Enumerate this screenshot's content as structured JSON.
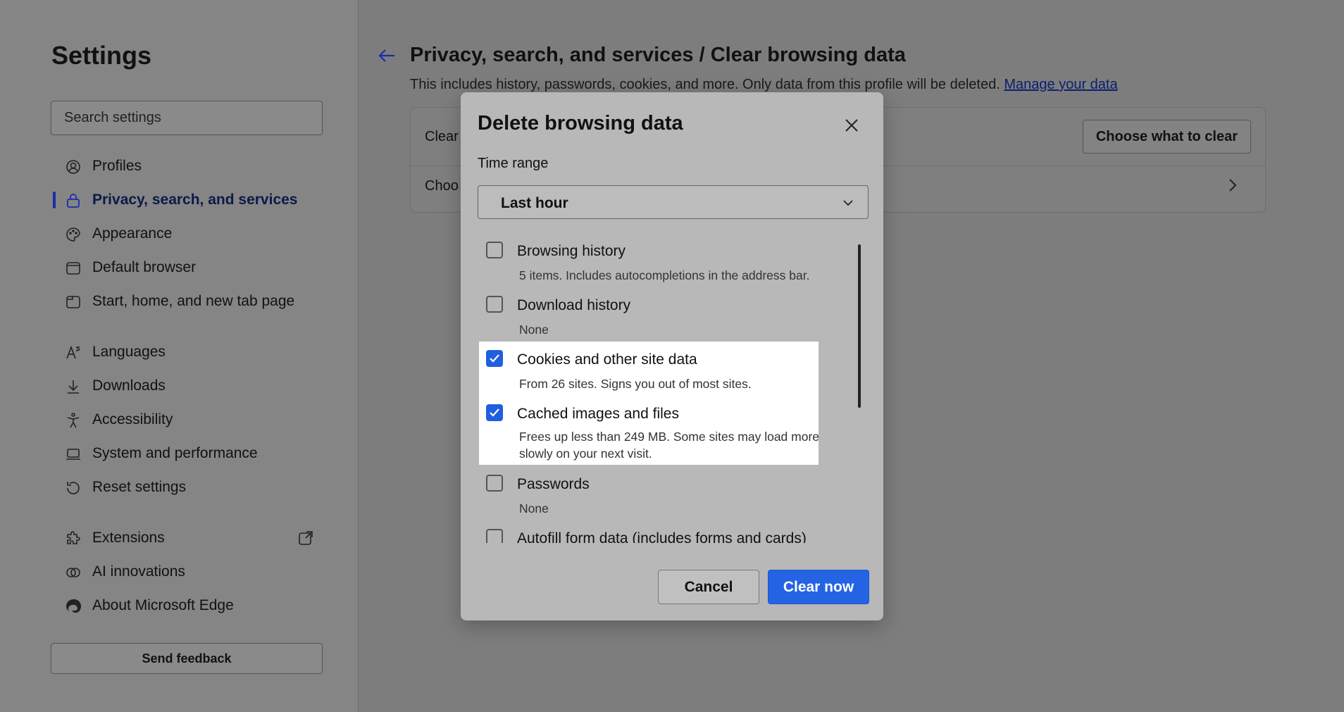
{
  "sidebar": {
    "title": "Settings",
    "search_placeholder": "Search settings",
    "items": [
      {
        "label": "Profiles",
        "icon": "profile-icon"
      },
      {
        "label": "Privacy, search, and services",
        "icon": "lock-icon",
        "active": true
      },
      {
        "label": "Appearance",
        "icon": "palette-icon"
      },
      {
        "label": "Default browser",
        "icon": "browser-icon"
      },
      {
        "label": "Start, home, and new tab page",
        "icon": "home-tab-icon"
      },
      {
        "label": "Languages",
        "icon": "languages-icon"
      },
      {
        "label": "Downloads",
        "icon": "download-icon"
      },
      {
        "label": "Accessibility",
        "icon": "accessibility-icon"
      },
      {
        "label": "System and performance",
        "icon": "laptop-icon"
      },
      {
        "label": "Reset settings",
        "icon": "reset-icon"
      },
      {
        "label": "Extensions",
        "icon": "puzzle-icon"
      },
      {
        "label": "AI innovations",
        "icon": "ai-icon"
      },
      {
        "label": "About Microsoft Edge",
        "icon": "edge-icon"
      }
    ],
    "feedback_label": "Send feedback"
  },
  "main": {
    "title": "Privacy, search, and services / Clear browsing data",
    "description": "This includes history, passwords, cookies, and more. Only data from this profile will be deleted.",
    "manage_link": "Manage your data",
    "card": {
      "row1": "Clear",
      "row2": "Choo",
      "button": "Choose what to clear"
    }
  },
  "dialog": {
    "title": "Delete browsing data",
    "time_range_label": "Time range",
    "time_range_value": "Last hour",
    "options": [
      {
        "label": "Browsing history",
        "desc": "5 items. Includes autocompletions in the address bar.",
        "checked": false
      },
      {
        "label": "Download history",
        "desc": "None",
        "checked": false
      },
      {
        "label": "Cookies and other site data",
        "desc": "From 26 sites. Signs you out of most sites.",
        "checked": true
      },
      {
        "label": "Cached images and files",
        "desc": "Frees up less than 249 MB. Some sites may load more slowly on your next visit.",
        "checked": true
      },
      {
        "label": "Passwords",
        "desc": "None",
        "checked": false
      },
      {
        "label": "Autofill form data (includes forms and cards)",
        "desc": "",
        "checked": false
      }
    ],
    "cancel_label": "Cancel",
    "clear_label": "Clear now"
  },
  "colors": {
    "accent": "#2463e3",
    "active_indicator": "#1c2da6",
    "dialog_bg": "#b8b8b8",
    "overlay_bg": "#7d7d7d"
  }
}
